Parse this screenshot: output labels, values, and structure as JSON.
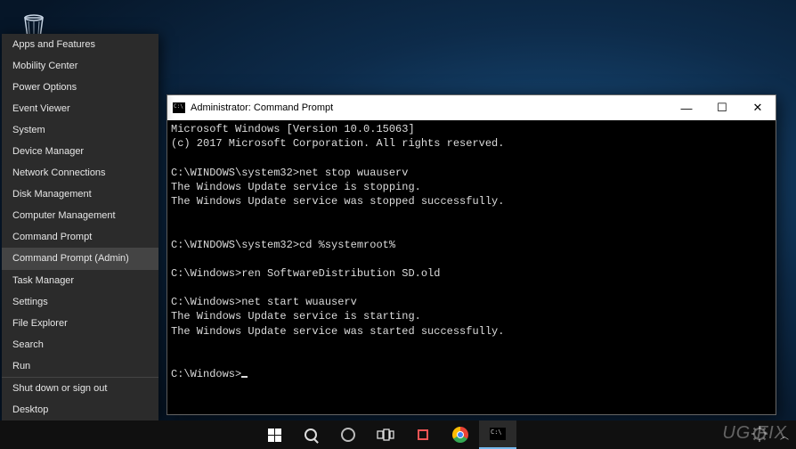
{
  "desktop": {
    "recycle_bin_label": "Recycle Bin"
  },
  "winx": {
    "group1": [
      "Apps and Features",
      "Mobility Center",
      "Power Options",
      "Event Viewer",
      "System",
      "Device Manager",
      "Network Connections",
      "Disk Management",
      "Computer Management",
      "Command Prompt",
      "Command Prompt (Admin)"
    ],
    "group2": [
      "Task Manager",
      "Settings",
      "File Explorer",
      "Search",
      "Run"
    ],
    "group3": [
      "Shut down or sign out",
      "Desktop"
    ],
    "selected_index": 10
  },
  "cmd": {
    "title": "Administrator: Command Prompt",
    "lines": {
      "ver": "Microsoft Windows [Version 10.0.15063]",
      "copy": "(c) 2017 Microsoft Corporation. All rights reserved.",
      "p1": "C:\\WINDOWS\\system32>",
      "c1": "net stop wuauserv",
      "r1a": "The Windows Update service is stopping.",
      "r1b": "The Windows Update service was stopped successfully.",
      "p2": "C:\\WINDOWS\\system32>",
      "c2": "cd %systemroot%",
      "p3": "C:\\Windows>",
      "c3": "ren SoftwareDistribution SD.old",
      "p4": "C:\\Windows>",
      "c4": "net start wuauserv",
      "r4a": "The Windows Update service is starting.",
      "r4b": "The Windows Update service was started successfully.",
      "p5": "C:\\Windows>"
    },
    "controls": {
      "minimize": "—",
      "maximize": "☐",
      "close": "✕"
    }
  },
  "watermark": "UG    FIX"
}
